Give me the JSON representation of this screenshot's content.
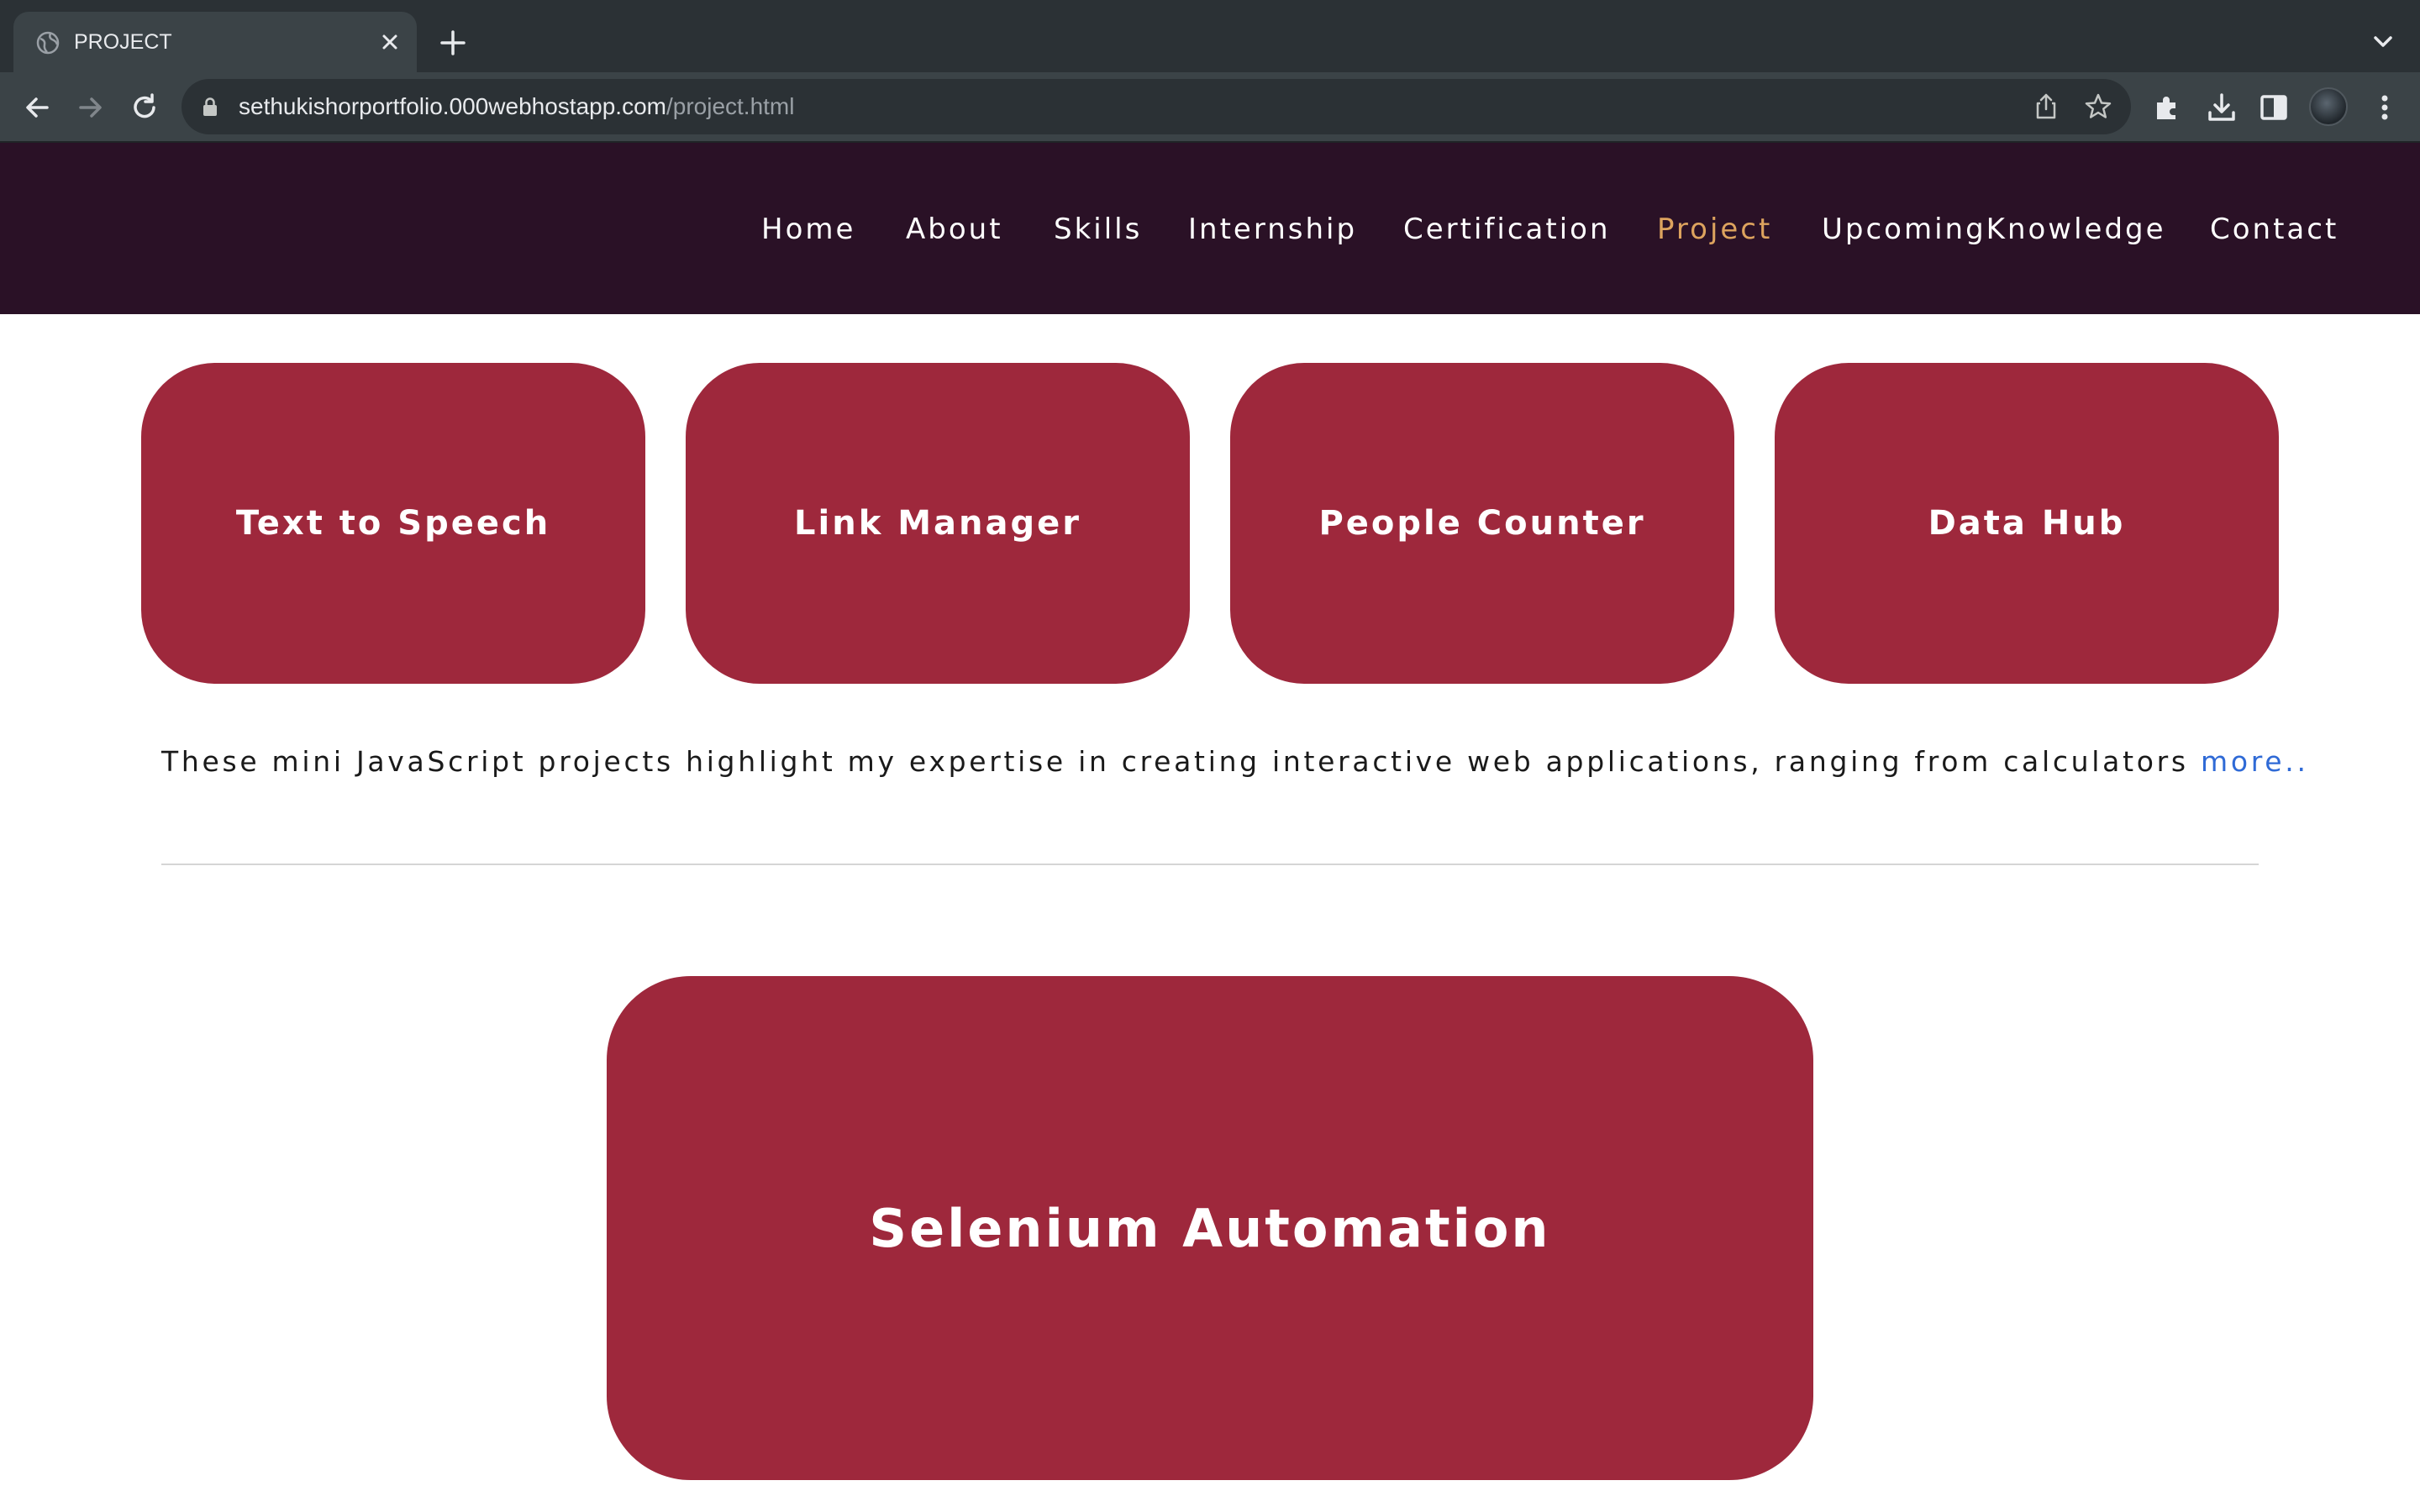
{
  "browser": {
    "tab": {
      "title": "PROJECT",
      "favicon": "globe-icon"
    },
    "url": {
      "host": "sethukishorportfolio.000webhostapp.com",
      "path": "/project.html"
    }
  },
  "nav": {
    "items": [
      {
        "label": "Home",
        "active": false
      },
      {
        "label": "About",
        "active": false
      },
      {
        "label": "Skills",
        "active": false
      },
      {
        "label": "Internship",
        "active": false
      },
      {
        "label": "Certification",
        "active": false
      },
      {
        "label": "Project",
        "active": true
      },
      {
        "label": "UpcomingKnowledge",
        "active": false
      },
      {
        "label": "Contact",
        "active": false
      }
    ]
  },
  "projects": {
    "cards": [
      {
        "label": "Text to Speech"
      },
      {
        "label": "Link Manager"
      },
      {
        "label": "People Counter"
      },
      {
        "label": "Data Hub"
      }
    ],
    "description": "These mini JavaScript projects highlight my expertise in creating interactive web applications, ranging from calculators",
    "more_link": "more..",
    "featured": {
      "label": "Selenium Automation"
    }
  },
  "colors": {
    "header_bg": "#2a1126",
    "nav_active": "#dda35e",
    "card_bg": "#9e283c",
    "link": "#2f6ad6"
  }
}
